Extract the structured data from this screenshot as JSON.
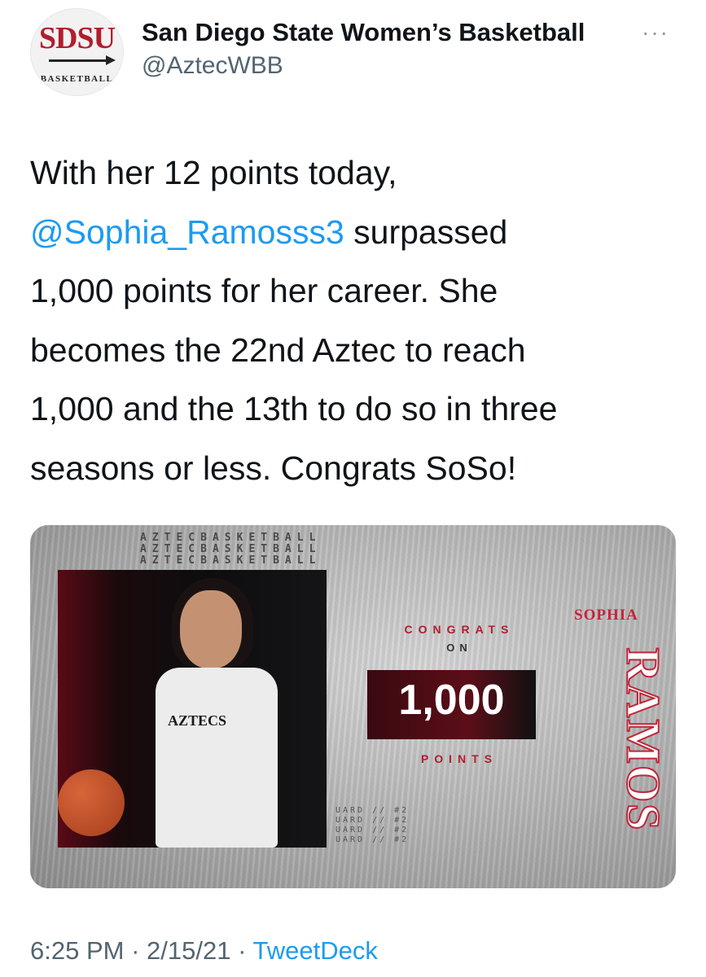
{
  "account": {
    "display_name": "San Diego State Women’s Basketball",
    "handle": "@AztecWBB",
    "avatar_logo": "SDSU",
    "avatar_sub": "BASKETBALL"
  },
  "tweet": {
    "line1": "With her 12 points today,",
    "mention": "@Sophia_Ramosss3",
    "after_mention": " surpassed",
    "rest_lines": [
      "1,000 points for her career. She",
      "becomes the 22nd Aztec to reach",
      "1,000 and the 13th to do so in three",
      "seasons or less. Congrats SoSo!"
    ]
  },
  "media": {
    "stripe_text": "AZTECBASKETBALL",
    "jersey_text": "AZTECS",
    "congrats": "CONGRATS",
    "on": "ON",
    "number": "1,000",
    "points": "POINTS",
    "first_name": "SOPHIA",
    "last_name": "RAMOS",
    "guard_text": "UARD // #2"
  },
  "footer": {
    "time": "6:25 PM",
    "date": "2/15/21",
    "separator": "·",
    "source": "TweetDeck"
  },
  "colors": {
    "brand_red": "#b01e2e",
    "link_blue": "#1d9bf0",
    "muted": "#536471"
  }
}
